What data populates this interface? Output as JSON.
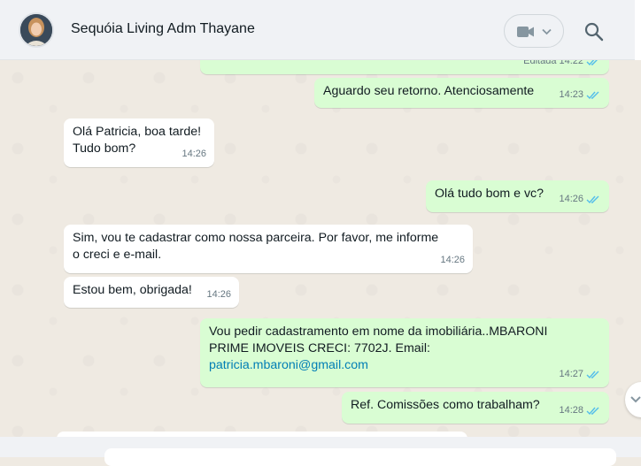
{
  "header": {
    "contact_name": "Sequóia Living Adm Thayane",
    "avatar_icon": "user-avatar-photo",
    "video_icon": "video-camera-icon",
    "search_icon": "search-icon"
  },
  "colors": {
    "outgoing_bubble": "#d9fdd3",
    "incoming_bubble": "#ffffff",
    "read_ticks": "#53bdeb",
    "link": "#027eb5",
    "chat_background": "#efeae2"
  },
  "messages": [
    {
      "id": "m0",
      "direction": "out",
      "lines": [],
      "edited_label": "Editada",
      "time": "14:22",
      "read": true
    },
    {
      "id": "m1",
      "direction": "out",
      "lines": [
        "Aguardo seu retorno. Atenciosamente"
      ],
      "time": "14:23",
      "read": true
    },
    {
      "id": "m2",
      "direction": "in",
      "lines": [
        "Olá Patricia, boa tarde!",
        "Tudo bom?"
      ],
      "time": "14:26"
    },
    {
      "id": "m3",
      "direction": "out",
      "lines": [
        "Olá tudo bom e vc?"
      ],
      "time": "14:26",
      "read": true
    },
    {
      "id": "m4",
      "direction": "in",
      "lines": [
        "Sim, vou te cadastrar como nossa parceira. Por favor, me informe",
        "o creci e e-mail."
      ],
      "time": "14:26"
    },
    {
      "id": "m5",
      "direction": "in",
      "lines": [
        "Estou bem, obrigada!"
      ],
      "time": "14:26"
    },
    {
      "id": "m6",
      "direction": "out",
      "lines": [
        "Vou pedir cadastramento em nome da imobiliária..MBARONI",
        "PRIME IMOVEIS  CRECI: 7702J. Email:"
      ],
      "link": "patricia.mbaroni@gmail.com",
      "time": "14:27",
      "read": true
    },
    {
      "id": "m7",
      "direction": "out",
      "lines": [
        "Ref. Comissões  como trabalham?"
      ],
      "time": "14:28",
      "read": true
    }
  ]
}
